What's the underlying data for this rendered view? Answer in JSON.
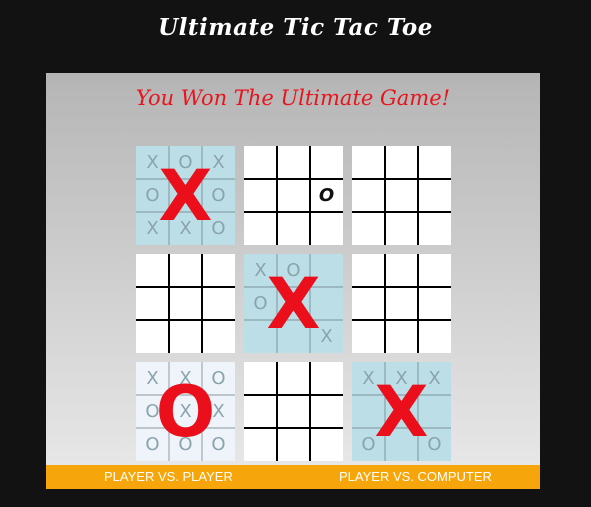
{
  "header": {
    "title": "Ultimate Tic Tac Toe"
  },
  "status": {
    "message": "You Won The Ultimate Game!"
  },
  "colors": {
    "won_board_bg": "#bcdfe7",
    "drawn_board_bg": "#eef4f9",
    "open_board_bg": "#ffffff",
    "grid_line": "#000000",
    "mark_red": "#ea0f1b",
    "mode_bar": "#f6a50b"
  },
  "boards": [
    {
      "state": "won",
      "winner": "X",
      "cells": [
        "X",
        "O",
        "X",
        "O",
        "",
        "O",
        "X",
        "X",
        "O"
      ]
    },
    {
      "state": "open",
      "winner": "",
      "cells": [
        "",
        "",
        "",
        "",
        "",
        "O",
        "",
        "",
        ""
      ]
    },
    {
      "state": "open",
      "winner": "",
      "cells": [
        "",
        "",
        "",
        "",
        "",
        "",
        "",
        "",
        ""
      ]
    },
    {
      "state": "open",
      "winner": "",
      "cells": [
        "",
        "",
        "",
        "",
        "",
        "",
        "",
        "",
        ""
      ]
    },
    {
      "state": "won",
      "winner": "X",
      "cells": [
        "X",
        "O",
        "",
        "O",
        "",
        "",
        "",
        "",
        "X"
      ]
    },
    {
      "state": "open",
      "winner": "",
      "cells": [
        "",
        "",
        "",
        "",
        "",
        "",
        "",
        "",
        ""
      ]
    },
    {
      "state": "drawn",
      "winner": "O",
      "cells": [
        "X",
        "X",
        "O",
        "O",
        "X",
        "X",
        "O",
        "O",
        "O"
      ]
    },
    {
      "state": "open",
      "winner": "",
      "cells": [
        "",
        "",
        "",
        "",
        "",
        "",
        "",
        "",
        ""
      ]
    },
    {
      "state": "won",
      "winner": "X",
      "cells": [
        "X",
        "X",
        "X",
        "",
        "",
        "",
        "O",
        "",
        "O"
      ]
    }
  ],
  "modes": {
    "pvp_label": "PLAYER VS. PLAYER",
    "pvc_label": "PLAYER VS. COMPUTER"
  }
}
